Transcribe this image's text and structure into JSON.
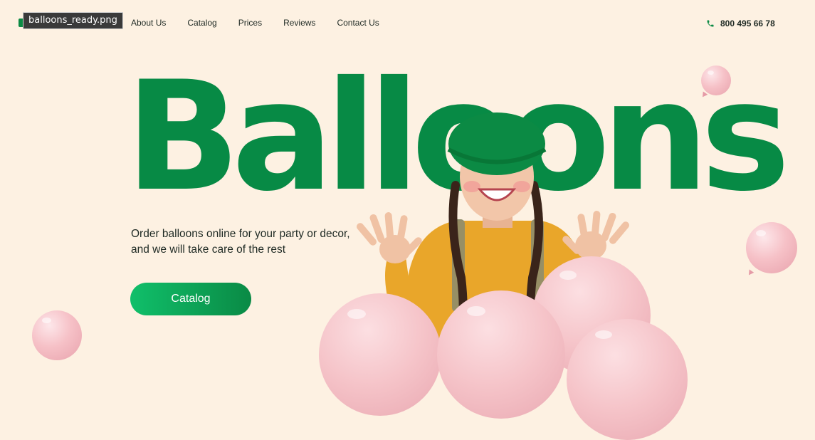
{
  "tooltip": {
    "filename": "balloons_ready.png"
  },
  "nav": {
    "items": [
      {
        "label": "About Us"
      },
      {
        "label": "Catalog"
      },
      {
        "label": "Prices"
      },
      {
        "label": "Reviews"
      },
      {
        "label": "Contact Us"
      }
    ]
  },
  "contact": {
    "phone": "800 495 66 78",
    "icon": "phone-icon"
  },
  "hero": {
    "title": "Balloons",
    "subtitle_line1": "Order balloons online for your party or decor,",
    "subtitle_line2": "and we will take care of the rest",
    "cta_label": "Catalog"
  },
  "colors": {
    "background": "#fdf1e2",
    "brand_green": "#078a45",
    "cta_gradient_start": "#10bf6a",
    "cta_gradient_end": "#0a8a45",
    "balloon_pink": "#f5c3c8",
    "sweater_yellow": "#e9a62a",
    "hat_green": "#0b8a44"
  }
}
